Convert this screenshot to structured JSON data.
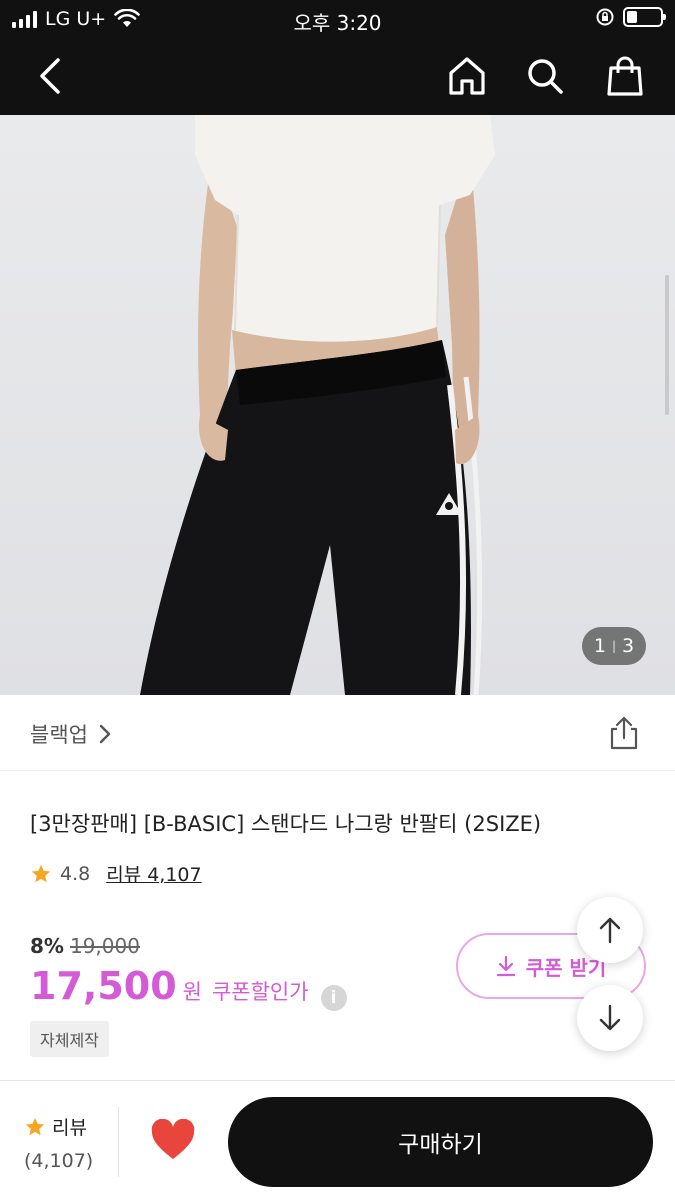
{
  "status_bar": {
    "carrier": "LG U+",
    "time": "오후 3:20"
  },
  "gallery": {
    "current": "1",
    "total": "3"
  },
  "brand": {
    "name": "블랙업"
  },
  "product": {
    "title": "[3만장판매] [B-BASIC] 스탠다드 나그랑 반팔티 (2SIZE)",
    "rating": "4.8",
    "review_label": "리뷰 4,107",
    "discount": "8%",
    "original_price": "19,000",
    "price": "17,500",
    "currency": "원",
    "coupon_price_label": "쿠폰할인가",
    "tag": "자체제작"
  },
  "coupon_button": {
    "label": "쿠폰 받기"
  },
  "bottom_bar": {
    "review_label": "리뷰",
    "review_count": "(4,107)",
    "buy_label": "구매하기"
  },
  "colors": {
    "accent": "#d55ad5",
    "star": "#f5a623",
    "heart": "#e8453c",
    "dark": "#111111"
  },
  "icons": [
    "back-icon",
    "home-icon",
    "search-icon",
    "cart-icon",
    "share-icon",
    "chevron-right-icon",
    "star-icon",
    "info-icon",
    "download-icon",
    "arrow-up-icon",
    "arrow-down-icon",
    "heart-icon",
    "wifi-icon",
    "battery-icon",
    "signal-icon",
    "rotation-lock-icon"
  ]
}
